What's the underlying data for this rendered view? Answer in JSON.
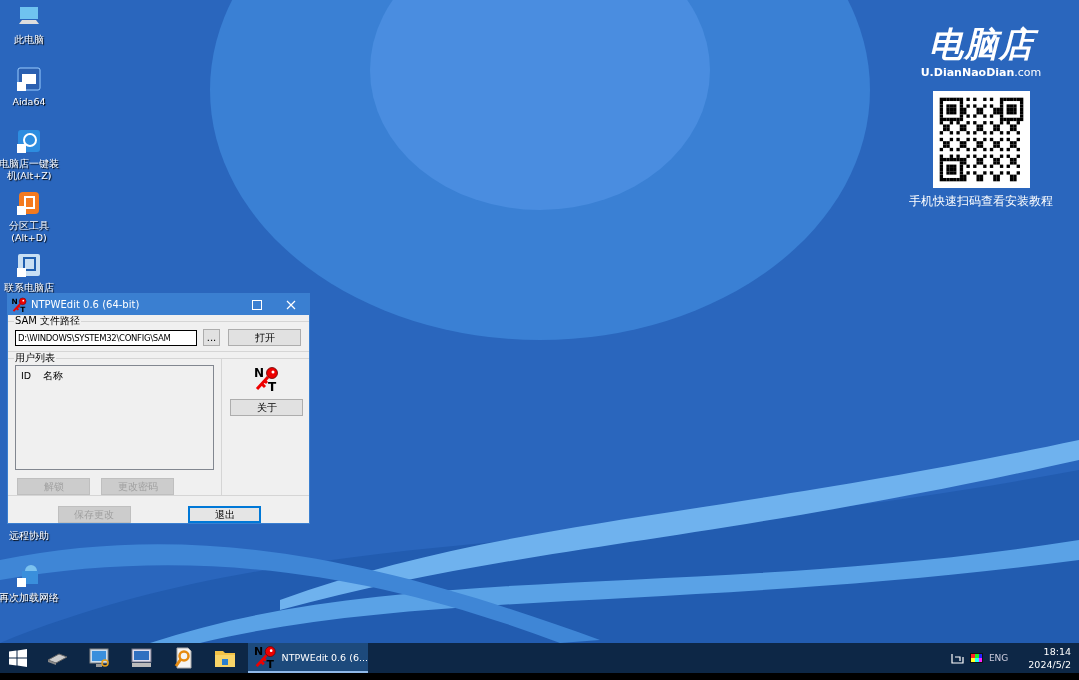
{
  "desktop_icons": [
    {
      "kind": "pc",
      "label": "此电脑"
    },
    {
      "kind": "aida",
      "label": "Aida64"
    },
    {
      "kind": "installer",
      "label": "电脑店一键装机(Alt+Z)"
    },
    {
      "kind": "partition",
      "label": "分区工具(Alt+D)"
    },
    {
      "kind": "contact",
      "label": "联系电脑店"
    },
    {
      "kind": "covered",
      "label": "远程协助"
    },
    {
      "kind": "network",
      "label": "再次加载网络"
    }
  ],
  "brand": {
    "logo": "电脑店",
    "site": "**U.DianNaoDian**.com",
    "caption": "手机快速扫码查看安装教程"
  },
  "window": {
    "title_logo": [
      "N",
      "T"
    ],
    "title": "NTPWEdit 0.6 (64-bit)",
    "about_logo": [
      "N",
      "T"
    ],
    "sam_group": {
      "label": "SAM 文件路径",
      "path": "D:\\WINDOWS\\SYSTEM32\\CONFIG\\SAM",
      "browse": "...",
      "open": "打开"
    },
    "users_group": {
      "label": "用户列表",
      "columns": [
        "ID",
        "名称"
      ]
    },
    "buttons": [
      {
        "kind": "list",
        "label": "解锁",
        "disabled": true,
        "focused": false
      },
      {
        "kind": "list",
        "label": "更改密码",
        "disabled": true,
        "focused": false
      },
      {
        "kind": "side",
        "label": "关于",
        "disabled": false,
        "focused": false
      },
      {
        "kind": "bottom",
        "label": "保存更改",
        "disabled": true,
        "focused": false
      },
      {
        "kind": "bottom",
        "label": "退出",
        "disabled": false,
        "focused": true
      }
    ]
  },
  "taskbar": {
    "apps": [
      {
        "kind": "ram"
      },
      {
        "kind": "monitor"
      },
      {
        "kind": "remote"
      },
      {
        "kind": "search-doc"
      },
      {
        "kind": "folder"
      }
    ],
    "task": {
      "logo": [
        "N",
        "T"
      ],
      "label": "NTPWEdit 0.6 (6...",
      "active": true
    },
    "tray": {
      "language": "ENG",
      "time": "18:14",
      "date": "2024/5/2"
    }
  }
}
